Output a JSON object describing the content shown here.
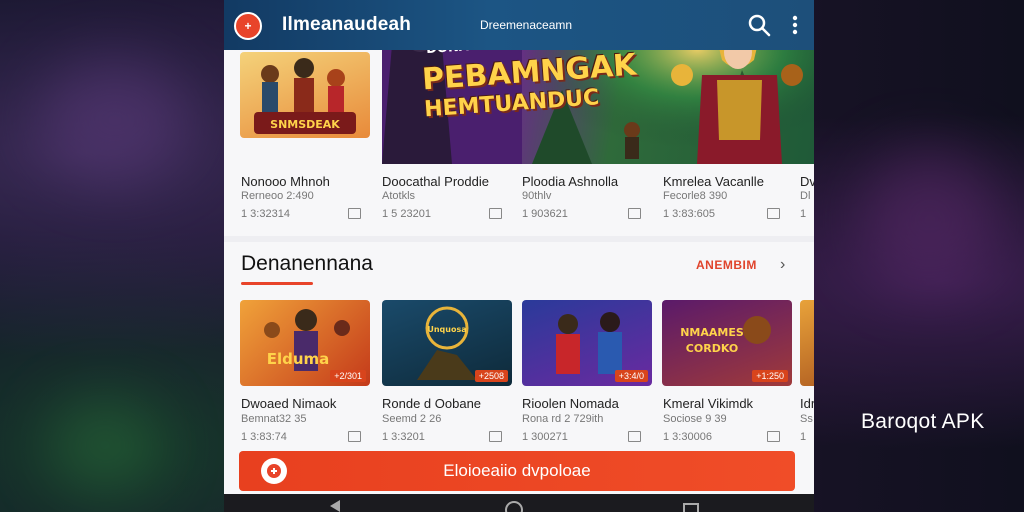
{
  "app": {
    "logo_label": "+",
    "title": "Ilmeanaudeah",
    "subtitle": "Dreemenaceamn"
  },
  "hero": {
    "banner_text_line1": "PEBAMNGAK",
    "banner_text_line2": "HEMTUANDUC",
    "banner_small": "DONAKE"
  },
  "top_row": [
    {
      "title": "Nonooo Mhnoh",
      "developer": "Rerneoo 2:490",
      "size": "1 3:32314"
    },
    {
      "title": "Doocathal Proddie",
      "developer": "Atotkls",
      "size": "1 5 23201"
    },
    {
      "title": "Ploodia Ashnolla",
      "developer": "90thlv",
      "size": "1 903621"
    },
    {
      "title": "Kmrelea Vacanlle",
      "developer": "Fecorle8 390",
      "size": "1 3:83:605"
    },
    {
      "title": "Dv",
      "developer": "Dl",
      "size": "1"
    }
  ],
  "section": {
    "title": "Denanennana",
    "see_all": "ANEMBIM"
  },
  "bottom_row": [
    {
      "title": "Dwoaed Nimaok",
      "developer": "Bemnat32 35",
      "size": "1 3:83:74",
      "price": "+2/301",
      "thumb_text": "Elduma"
    },
    {
      "title": "Ronde d Oobane",
      "developer": "Seemd 2 26",
      "size": "1 3:3201",
      "price": "+2508",
      "thumb_text": "Unquosa"
    },
    {
      "title": "Rioolen Nomada",
      "developer": "Rona rd 2 729ith",
      "size": "1 300271",
      "price": "+3:4/0",
      "thumb_text": ""
    },
    {
      "title": "Kmeral Vikimdk",
      "developer": "Sociose 9 39",
      "size": "1 3:30006",
      "price": "+1:250",
      "thumb_text": "NMAAMES CORDKO"
    },
    {
      "title": "Idr",
      "developer": "Ss",
      "size": "1",
      "price": "",
      "thumb_text": ""
    }
  ],
  "cta": {
    "label": "Eloioeaiio dvpoloae"
  },
  "brand": {
    "label": "Baroqot APK"
  },
  "colors": {
    "accent": "#e8442a",
    "topbar": "#1c5584",
    "background": "#f7f7f9"
  }
}
